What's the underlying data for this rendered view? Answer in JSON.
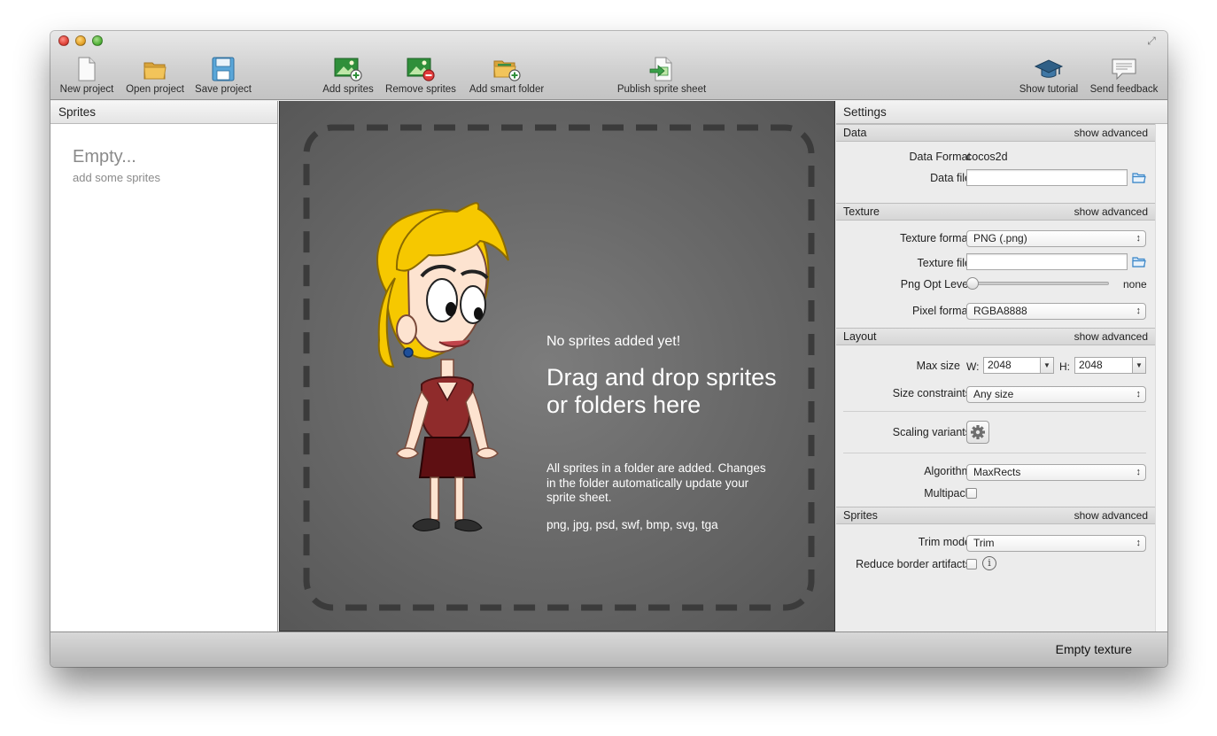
{
  "toolbar": {
    "new_project": "New project",
    "open_project": "Open project",
    "save_project": "Save project",
    "add_sprites": "Add sprites",
    "remove_sprites": "Remove sprites",
    "add_smart_folder": "Add smart folder",
    "publish": "Publish sprite sheet",
    "show_tutorial": "Show tutorial",
    "send_feedback": "Send feedback"
  },
  "sprites_panel": {
    "title": "Sprites",
    "empty_title": "Empty...",
    "empty_sub": "add some sprites"
  },
  "drop_area": {
    "no_sprites": "No sprites added yet!",
    "drag_drop": "Drag and drop sprites or folders here",
    "info": "All sprites in a folder are added. Changes in the folder automatically update your sprite sheet.",
    "formats": "png, jpg, psd, swf, bmp, svg, tga"
  },
  "settings": {
    "title": "Settings",
    "show_advanced": "show advanced",
    "data": {
      "title": "Data",
      "data_format_label": "Data Format",
      "data_format_value": "cocos2d",
      "data_file_label": "Data file",
      "data_file_value": ""
    },
    "texture": {
      "title": "Texture",
      "texture_format_label": "Texture format",
      "texture_format_value": "PNG (.png)",
      "texture_file_label": "Texture file",
      "texture_file_value": "",
      "png_opt_label": "Png Opt Level",
      "png_opt_value": "none",
      "png_opt_level": 0,
      "pixel_format_label": "Pixel format",
      "pixel_format_value": "RGBA8888"
    },
    "layout": {
      "title": "Layout",
      "max_size_label": "Max size",
      "w_label": "W:",
      "w_value": "2048",
      "h_label": "H:",
      "h_value": "2048",
      "size_constraints_label": "Size constraints",
      "size_constraints_value": "Any size",
      "scaling_variants_label": "Scaling variants",
      "algorithm_label": "Algorithm",
      "algorithm_value": "MaxRects",
      "multipack_label": "Multipack",
      "multipack_checked": false
    },
    "sprites": {
      "title": "Sprites",
      "trim_mode_label": "Trim mode",
      "trim_mode_value": "Trim",
      "reduce_border_label": "Reduce border artifacts",
      "reduce_border_checked": false
    }
  },
  "status": {
    "text": "Empty texture"
  },
  "colors": {
    "drop_bg": "#6a6a6a",
    "dash_border": "#3a3a3a",
    "accent_green": "#2e8b3a",
    "folder_blue": "#3a86c8"
  }
}
